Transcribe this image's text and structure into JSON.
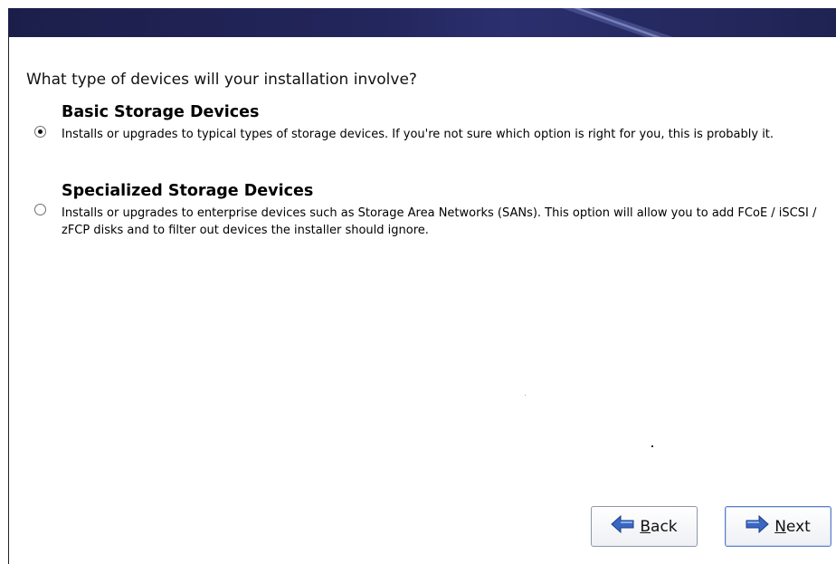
{
  "header": {
    "brand_color": "#1f2352"
  },
  "question": "What type of devices will your installation involve?",
  "options": [
    {
      "title": "Basic Storage Devices",
      "description": "Installs or upgrades to typical types of storage devices.  If you're not sure which option is right for you, this is probably it.",
      "selected": true
    },
    {
      "title": "Specialized Storage Devices",
      "description": "Installs or upgrades to enterprise devices such as Storage Area Networks (SANs). This option will allow you to add FCoE / iSCSI / zFCP disks and to filter out devices the installer should ignore.",
      "selected": false
    }
  ],
  "buttons": {
    "back": {
      "mnemonic": "B",
      "rest": "ack",
      "icon": "arrow-left-icon"
    },
    "next": {
      "mnemonic": "N",
      "rest": "ext",
      "icon": "arrow-right-icon"
    }
  },
  "colors": {
    "arrow_blue": "#3a66c4"
  }
}
